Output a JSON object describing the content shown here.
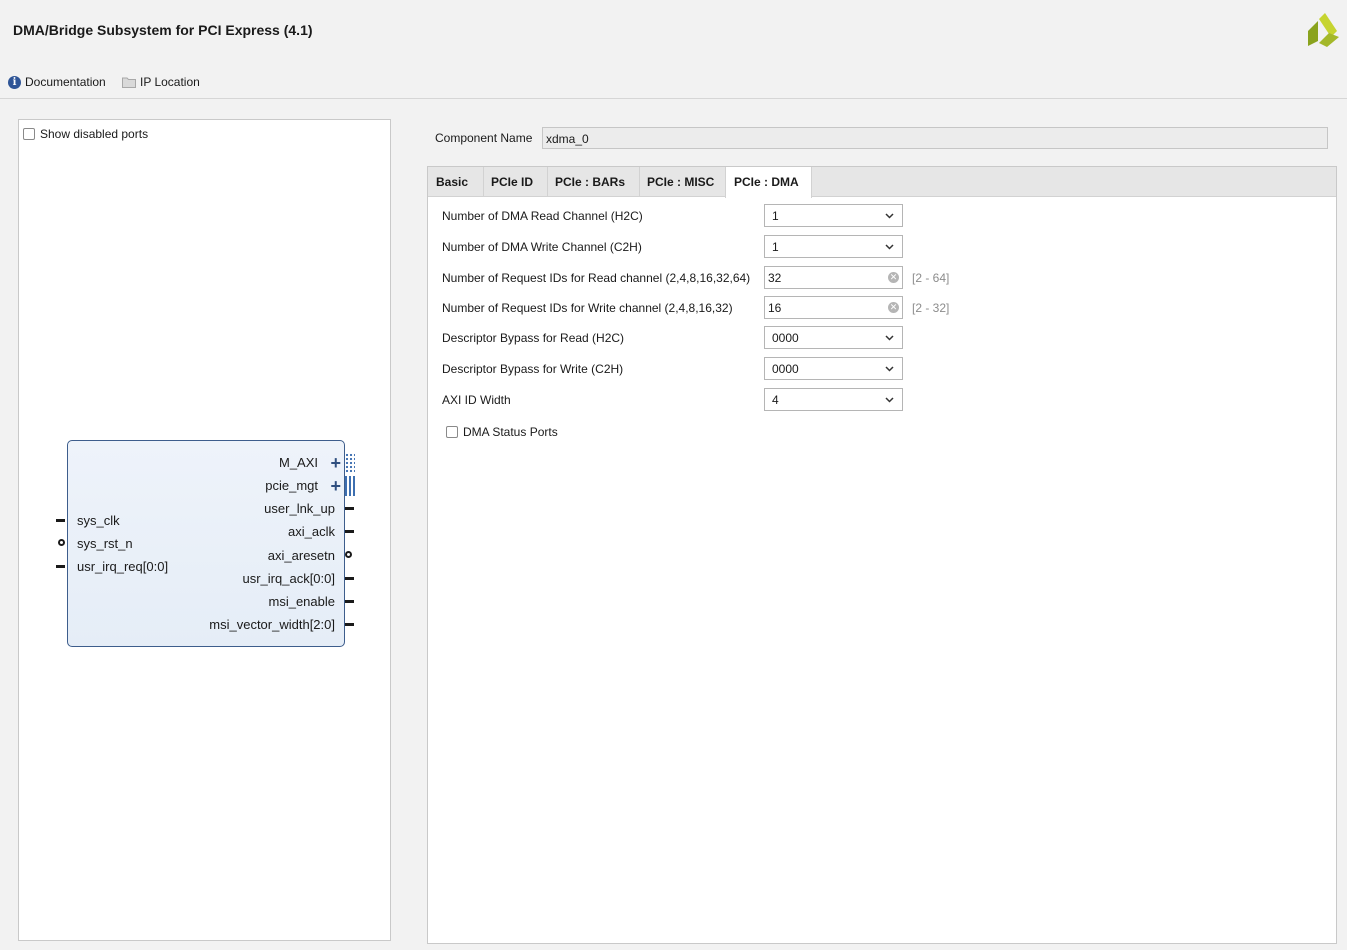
{
  "header": {
    "title": "DMA/Bridge Subsystem for PCI Express (4.1)",
    "documentation_label": "Documentation",
    "ip_location_label": "IP Location"
  },
  "left_panel": {
    "show_disabled_ports_label": "Show disabled ports",
    "show_disabled_ports_checked": false,
    "block": {
      "left_ports": [
        "sys_clk",
        "sys_rst_n",
        "usr_irq_req[0:0]"
      ],
      "right_ports": [
        "M_AXI",
        "pcie_mgt",
        "user_lnk_up",
        "axi_aclk",
        "axi_aresetn",
        "usr_irq_ack[0:0]",
        "msi_enable",
        "msi_vector_width[2:0]"
      ]
    }
  },
  "component": {
    "label": "Component Name",
    "value": "xdma_0"
  },
  "tabs": [
    {
      "label": "Basic",
      "active": false
    },
    {
      "label": "PCIe ID",
      "active": false
    },
    {
      "label": "PCIe : BARs",
      "active": false
    },
    {
      "label": "PCIe : MISC",
      "active": false
    },
    {
      "label": "PCIe : DMA",
      "active": true
    }
  ],
  "params": [
    {
      "label": "Number of DMA Read Channel (H2C)",
      "type": "select",
      "value": "1"
    },
    {
      "label": "Number of DMA Write Channel (C2H)",
      "type": "select",
      "value": "1"
    },
    {
      "label": "Number of Request IDs for Read channel (2,4,8,16,32,64)",
      "type": "text",
      "value": "32",
      "range": "[2 - 64]"
    },
    {
      "label": "Number of Request IDs for Write channel (2,4,8,16,32)",
      "type": "text",
      "value": "16",
      "range": "[2 - 32]"
    },
    {
      "label": "Descriptor Bypass for Read (H2C)",
      "type": "select",
      "value": "0000"
    },
    {
      "label": "Descriptor Bypass for Write (C2H)",
      "type": "select",
      "value": "0000"
    },
    {
      "label": "AXI ID Width",
      "type": "select",
      "value": "4"
    }
  ],
  "dma_status_ports": {
    "label": "DMA Status Ports",
    "checked": false
  },
  "colors": {
    "brand_logo": "#8aa31e",
    "block_border": "#3d5d8c",
    "info_icon": "#2f5597"
  }
}
